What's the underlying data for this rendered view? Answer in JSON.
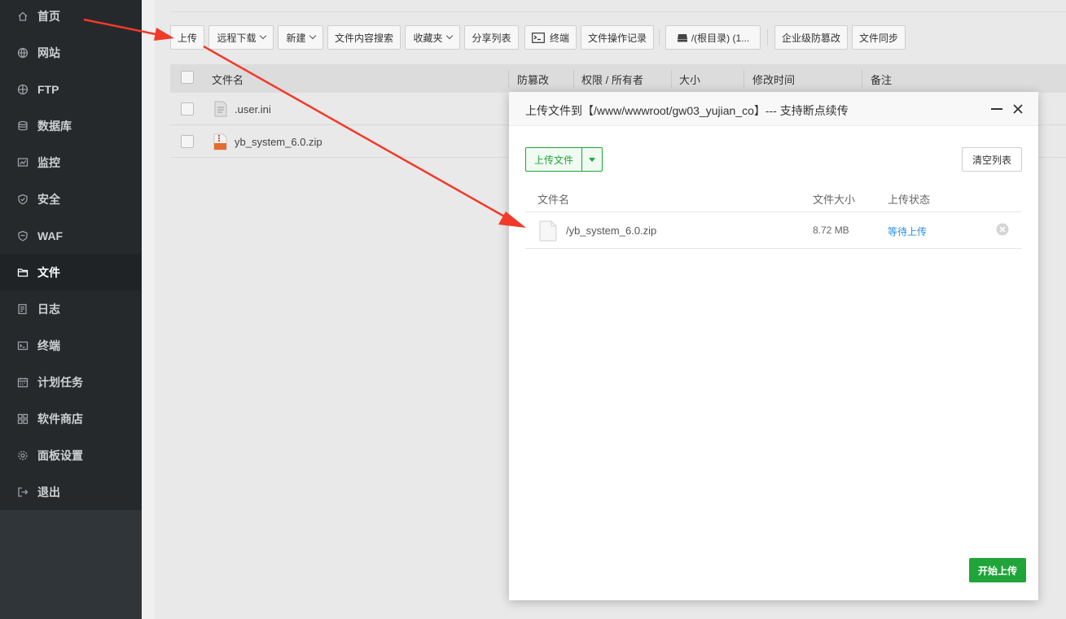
{
  "sidebar": {
    "items": [
      {
        "label": "首页",
        "icon": "home-icon"
      },
      {
        "label": "网站",
        "icon": "globe-icon"
      },
      {
        "label": "FTP",
        "icon": "ftp-icon"
      },
      {
        "label": "数据库",
        "icon": "database-icon"
      },
      {
        "label": "监控",
        "icon": "monitor-icon"
      },
      {
        "label": "安全",
        "icon": "shield-icon"
      },
      {
        "label": "WAF",
        "icon": "waf-shield-icon"
      },
      {
        "label": "文件",
        "icon": "folder-icon",
        "active": true
      },
      {
        "label": "日志",
        "icon": "log-icon"
      },
      {
        "label": "终端",
        "icon": "terminal-icon"
      },
      {
        "label": "计划任务",
        "icon": "calendar-icon"
      },
      {
        "label": "软件商店",
        "icon": "grid-icon"
      },
      {
        "label": "面板设置",
        "icon": "gear-icon"
      },
      {
        "label": "退出",
        "icon": "logout-icon"
      }
    ]
  },
  "toolbar": {
    "upload": "上传",
    "remote_download": "远程下载",
    "new": "新建",
    "content_search": "文件内容搜索",
    "favorites": "收藏夹",
    "share_list": "分享列表",
    "terminal": "终端",
    "operation_log": "文件操作记录",
    "disk": "/(根目录) (1...",
    "tamper_proof": "企业级防篡改",
    "file_sync": "文件同步"
  },
  "file_table": {
    "headers": [
      "文件名",
      "防篡改",
      "权限 / 所有者",
      "大小",
      "修改时间",
      "备注"
    ],
    "rows": [
      {
        "name": ".user.ini",
        "icon": "text-file-icon"
      },
      {
        "name": "yb_system_6.0.zip",
        "icon": "zip-file-icon"
      }
    ]
  },
  "upload_dialog": {
    "title": "上传文件到【/www/wwwroot/gw03_yujian_co】--- 支持断点续传",
    "upload_button": "上传文件",
    "clear_button": "清空列表",
    "headers": {
      "name": "文件名",
      "size": "文件大小",
      "status": "上传状态"
    },
    "files": [
      {
        "name": "/yb_system_6.0.zip",
        "size": "8.72 MB",
        "status": "等待上传"
      }
    ],
    "start_button": "开始上传"
  },
  "colors": {
    "accent_green": "#20a53a",
    "status_blue": "#2a8de0",
    "annotation_red": "#f23a2a",
    "sidebar_bg": "#25292c"
  }
}
